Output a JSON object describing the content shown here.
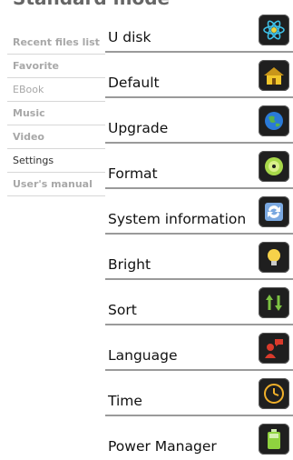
{
  "header": {
    "title": "Standard mode"
  },
  "left_menu": [
    {
      "label": "Recent files list"
    },
    {
      "label": "Favorite"
    },
    {
      "label": "EBook"
    },
    {
      "label": "Music"
    },
    {
      "label": "Video"
    },
    {
      "label": "Settings"
    },
    {
      "label": "User's manual"
    }
  ],
  "settings": [
    {
      "label": "U disk",
      "icon": "atom-icon"
    },
    {
      "label": "Default",
      "icon": "house-icon"
    },
    {
      "label": "Upgrade",
      "icon": "globe-icon"
    },
    {
      "label": "Format",
      "icon": "disc-icon"
    },
    {
      "label": "System information",
      "icon": "sync-icon"
    },
    {
      "label": "Bright",
      "icon": "bulb-icon"
    },
    {
      "label": "Sort",
      "icon": "sort-arrows-icon"
    },
    {
      "label": "Language",
      "icon": "speaking-person-icon"
    },
    {
      "label": "Time",
      "icon": "clock-icon"
    },
    {
      "label": "Power Manager",
      "icon": "battery-icon"
    }
  ]
}
